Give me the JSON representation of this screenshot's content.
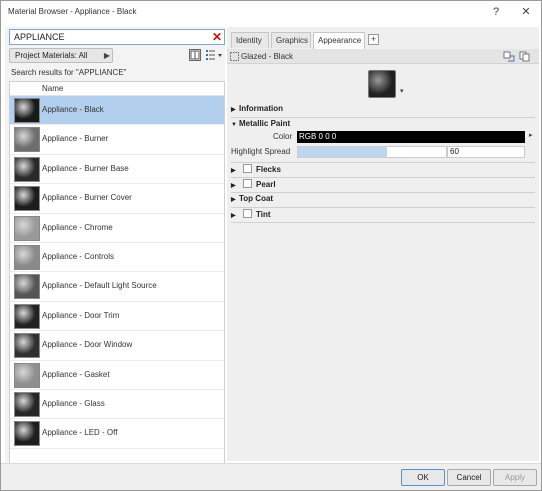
{
  "window": {
    "title": "Material Browser - Appliance - Black",
    "help_label": "?",
    "close_label": "✕"
  },
  "search": {
    "value": "APPLIANCE",
    "clear_icon": "close-icon"
  },
  "library": {
    "dropdown_label": "Project Materials: All",
    "dropdown_arrow": "▶"
  },
  "results": {
    "label": "Search results for \"APPLIANCE\"",
    "column_header": "Name",
    "items": [
      {
        "label": "Appliance - Black",
        "swatch": "#1a1a1a",
        "selected": true
      },
      {
        "label": "Appliance - Burner",
        "swatch": "#6e6e6e",
        "selected": false
      },
      {
        "label": "Appliance - Burner Base",
        "swatch": "#2a2a2a",
        "selected": false
      },
      {
        "label": "Appliance - Burner Cover",
        "swatch": "#1c1c1c",
        "selected": false
      },
      {
        "label": "Appliance - Chrome",
        "swatch": "#9a9a9a",
        "selected": false
      },
      {
        "label": "Appliance - Controls",
        "swatch": "#8a8a8a",
        "selected": false
      },
      {
        "label": "Appliance - Default Light Source",
        "swatch": "#555555",
        "selected": false
      },
      {
        "label": "Appliance - Door Trim",
        "swatch": "#222222",
        "selected": false
      },
      {
        "label": "Appliance - Door Window",
        "swatch": "#303030",
        "selected": false
      },
      {
        "label": "Appliance - Gasket",
        "swatch": "#8f8f8f",
        "selected": false
      },
      {
        "label": "Appliance - Glass",
        "swatch": "#262626",
        "selected": false
      },
      {
        "label": "Appliance - LED - Off",
        "swatch": "#1e1e1e",
        "selected": false
      }
    ]
  },
  "footer": {
    "collapse_label": "«"
  },
  "editor": {
    "tabs": [
      {
        "label": "Identity",
        "active": false
      },
      {
        "label": "Graphics",
        "active": false
      },
      {
        "label": "Appearance",
        "active": true
      }
    ],
    "add_tab_label": "+",
    "asset_name": "Glazed - Black",
    "sections": {
      "information": "Information",
      "metallic_paint": "Metallic Paint",
      "flecks": "Flecks",
      "pearl": "Pearl",
      "top_coat": "Top Coat",
      "tint": "Tint"
    },
    "color": {
      "label": "Color",
      "value": "RGB 0 0 0",
      "swatch": "#000000"
    },
    "highlight_spread": {
      "label": "Highlight Spread",
      "value": "60",
      "fill_fraction": 0.6
    }
  },
  "buttons": {
    "ok": "OK",
    "cancel": "Cancel",
    "apply": "Apply"
  }
}
